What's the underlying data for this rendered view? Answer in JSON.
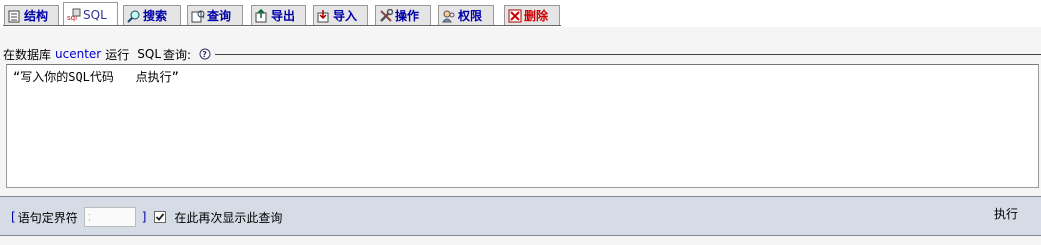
{
  "tabs": [
    {
      "label": "结构",
      "icon": "structure-icon"
    },
    {
      "label": "SQL",
      "icon": "sql-icon",
      "active": true
    },
    {
      "label": "搜索",
      "icon": "search-icon"
    },
    {
      "label": "查询",
      "icon": "query-icon"
    },
    {
      "label": "导出",
      "icon": "export-icon"
    },
    {
      "label": "导入",
      "icon": "import-icon"
    },
    {
      "label": "操作",
      "icon": "operations-icon"
    },
    {
      "label": "权限",
      "icon": "privileges-icon"
    },
    {
      "label": "删除",
      "icon": "drop-icon",
      "danger": true
    }
  ],
  "legend": {
    "prefix": "在数据库",
    "database": "ucenter",
    "run": "运行",
    "sql": "SQL",
    "query": "查询:",
    "help_icon": "help-icon"
  },
  "editor": {
    "value": "“写入你的SQL代码   点执行”"
  },
  "footer": {
    "bracket_open": "[",
    "delimiter_label": "语句定界符",
    "delimiter_value": ";",
    "bracket_close": "]",
    "show_again_label": "在此再次显示此查询",
    "show_again_checked": true,
    "execute_label": "执行"
  },
  "colors": {
    "link": "#0000cc",
    "danger": "#cc0000",
    "footer_bg": "#d5dce6"
  }
}
